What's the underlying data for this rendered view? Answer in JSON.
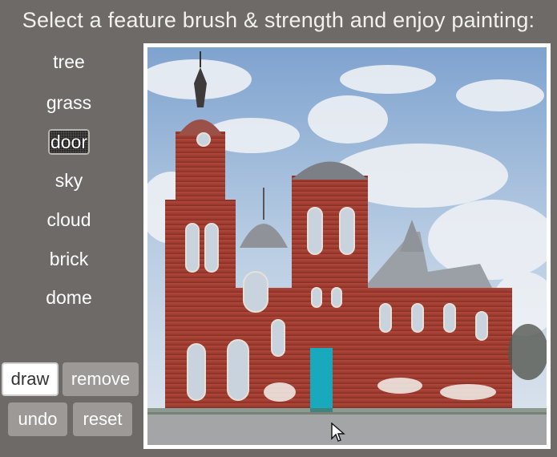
{
  "title": "Select a feature brush & strength and enjoy painting:",
  "brushes": [
    {
      "label": "tree",
      "selected": false
    },
    {
      "label": "grass",
      "selected": false
    },
    {
      "label": "door",
      "selected": true
    },
    {
      "label": "sky",
      "selected": false
    },
    {
      "label": "cloud",
      "selected": false
    },
    {
      "label": "brick",
      "selected": false
    },
    {
      "label": "dome",
      "selected": false
    }
  ],
  "buttons": {
    "draw": "draw",
    "remove": "remove",
    "undo": "undo",
    "reset": "reset"
  },
  "active_tool": "draw",
  "colors": {
    "background": "#6d6a67",
    "painted_door": "#19a9bd",
    "button": "#9c9996"
  },
  "canvas": {
    "content": "church-painting-canvas",
    "cursor_icon": "arrow-cursor-icon"
  }
}
